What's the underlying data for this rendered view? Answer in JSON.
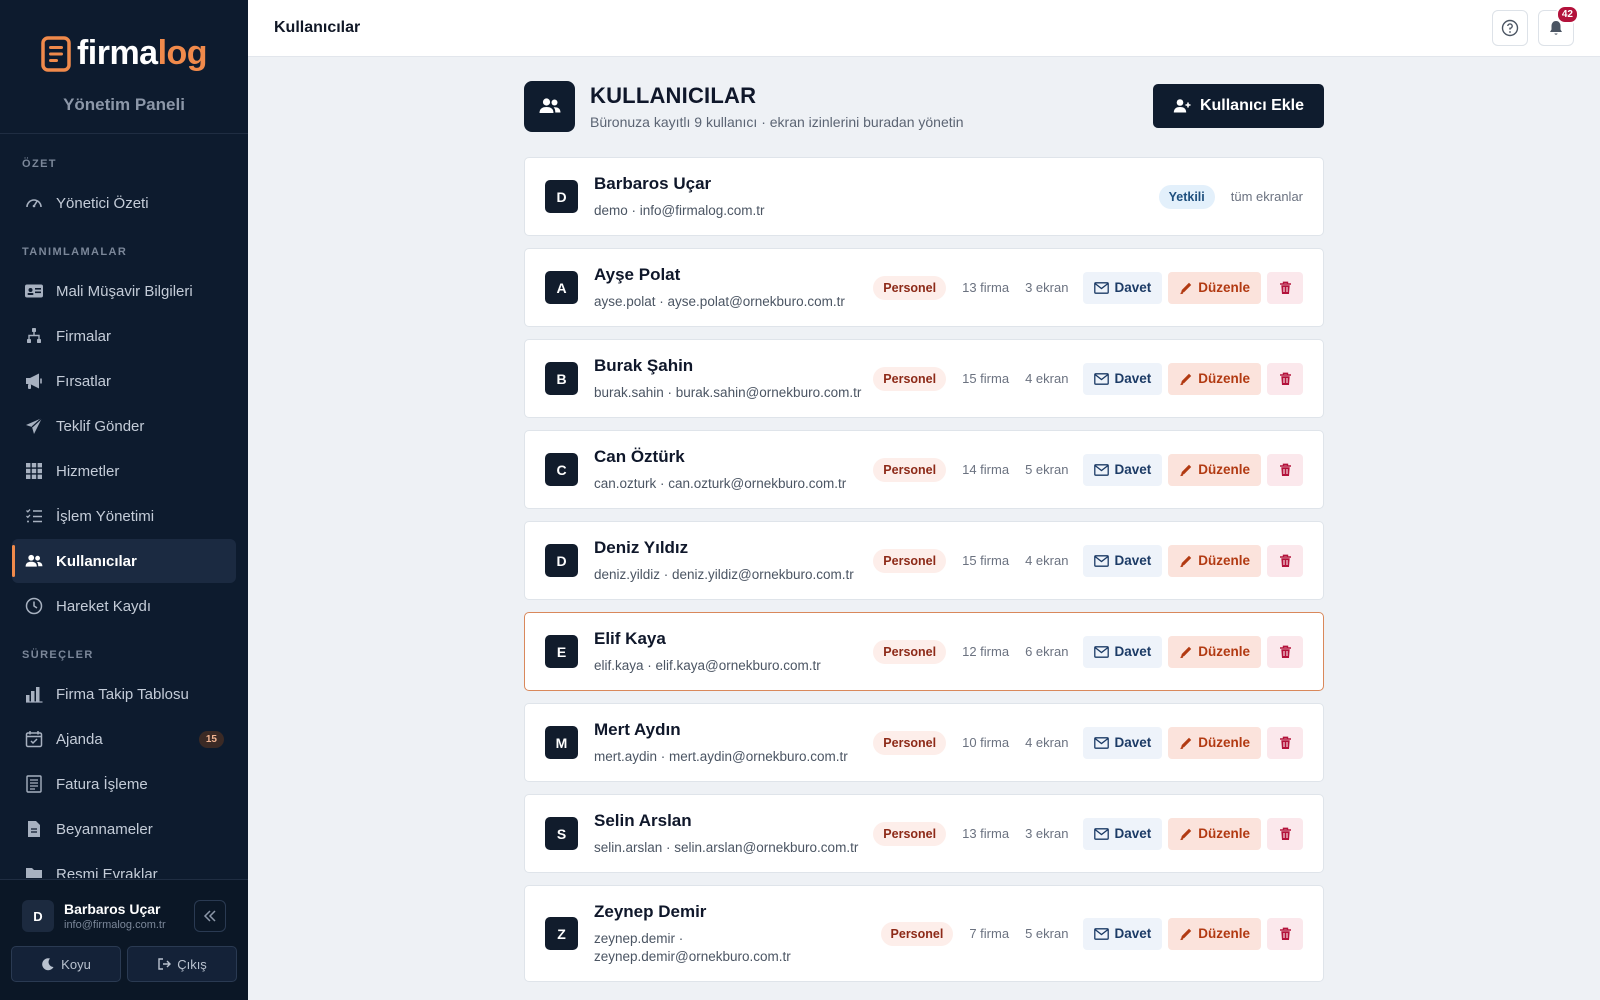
{
  "brand": {
    "word_a": "firma",
    "word_b": "log",
    "subtitle": "Yönetim Paneli",
    "accent": "#f08a4b"
  },
  "sidebar": {
    "sections": [
      {
        "title": "ÖZET",
        "items": [
          {
            "label": "Yönetici Özeti",
            "icon": "dashboard-icon"
          }
        ]
      },
      {
        "title": "TANIMLAMALAR",
        "items": [
          {
            "label": "Mali Müşavir Bilgileri",
            "icon": "id-card-icon"
          },
          {
            "label": "Firmalar",
            "icon": "sitemap-icon"
          },
          {
            "label": "Fırsatlar",
            "icon": "megaphone-icon"
          },
          {
            "label": "Teklif Gönder",
            "icon": "paper-plane-icon"
          },
          {
            "label": "Hizmetler",
            "icon": "grid-icon"
          },
          {
            "label": "İşlem Yönetimi",
            "icon": "list-icon"
          },
          {
            "label": "Kullanıcılar",
            "icon": "users-icon",
            "active": true
          },
          {
            "label": "Hareket Kaydı",
            "icon": "clock-icon"
          }
        ]
      },
      {
        "title": "SÜREÇLER",
        "items": [
          {
            "label": "Firma Takip Tablosu",
            "icon": "bar-chart-icon"
          },
          {
            "label": "Ajanda",
            "icon": "calendar-check-icon",
            "badge": "15"
          },
          {
            "label": "Fatura İşleme",
            "icon": "invoice-icon"
          },
          {
            "label": "Beyannameler",
            "icon": "document-icon"
          },
          {
            "label": "Resmi Evraklar",
            "icon": "folder-icon"
          }
        ]
      }
    ],
    "footer": {
      "user_initial": "D",
      "user_name": "Barbaros Uçar",
      "user_email": "info@firmalog.com.tr",
      "theme_label": "Koyu",
      "logout_label": "Çıkış"
    }
  },
  "topbar": {
    "title": "Kullanıcılar",
    "notification_count": "42"
  },
  "header": {
    "title": "KULLANICILAR",
    "subtitle": "Büronuza kayıtlı 9 kullanıcı · ekran izinlerini buradan yönetin",
    "add_button": "Kullanıcı Ekle"
  },
  "actions": {
    "invite": "Davet",
    "edit": "Düzenle"
  },
  "users": [
    {
      "initial": "D",
      "name": "Barbaros Uçar",
      "sub": "demo · info@firmalog.com.tr",
      "role": "Yetkili",
      "role_type": "auth",
      "screens_note": "tüm ekranlar"
    },
    {
      "initial": "A",
      "name": "Ayşe Polat",
      "sub": "ayse.polat · ayse.polat@ornekburo.com.tr",
      "role": "Personel",
      "role_type": "staff",
      "firms": "13 firma",
      "screens": "3 ekran"
    },
    {
      "initial": "B",
      "name": "Burak Şahin",
      "sub": "burak.sahin · burak.sahin@ornekburo.com.tr",
      "role": "Personel",
      "role_type": "staff",
      "firms": "15 firma",
      "screens": "4 ekran"
    },
    {
      "initial": "C",
      "name": "Can Öztürk",
      "sub": "can.ozturk · can.ozturk@ornekburo.com.tr",
      "role": "Personel",
      "role_type": "staff",
      "firms": "14 firma",
      "screens": "5 ekran"
    },
    {
      "initial": "D",
      "name": "Deniz Yıldız",
      "sub": "deniz.yildiz · deniz.yildiz@ornekburo.com.tr",
      "role": "Personel",
      "role_type": "staff",
      "firms": "15 firma",
      "screens": "4 ekran"
    },
    {
      "initial": "E",
      "name": "Elif Kaya",
      "sub": "elif.kaya · elif.kaya@ornekburo.com.tr",
      "role": "Personel",
      "role_type": "staff",
      "firms": "12 firma",
      "screens": "6 ekran",
      "selected": true
    },
    {
      "initial": "M",
      "name": "Mert Aydın",
      "sub": "mert.aydin · mert.aydin@ornekburo.com.tr",
      "role": "Personel",
      "role_type": "staff",
      "firms": "10 firma",
      "screens": "4 ekran"
    },
    {
      "initial": "S",
      "name": "Selin Arslan",
      "sub": "selin.arslan · selin.arslan@ornekburo.com.tr",
      "role": "Personel",
      "role_type": "staff",
      "firms": "13 firma",
      "screens": "3 ekran"
    },
    {
      "initial": "Z",
      "name": "Zeynep Demir",
      "sub": "zeynep.demir · zeynep.demir@ornekburo.com.tr",
      "role": "Personel",
      "role_type": "staff",
      "firms": "7 firma",
      "screens": "5 ekran",
      "tall": true
    }
  ]
}
